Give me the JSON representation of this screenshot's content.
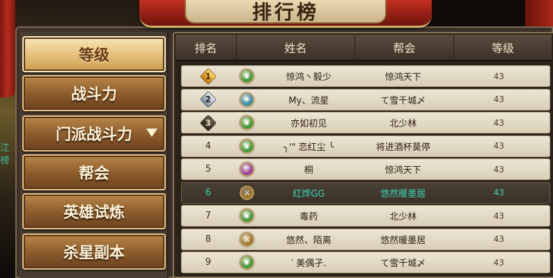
{
  "title": "排行榜",
  "side_glyph": "江\n榜",
  "menu": {
    "items": [
      {
        "label": "等级",
        "active": true,
        "dropdown": false
      },
      {
        "label": "战斗力",
        "active": false,
        "dropdown": false
      },
      {
        "label": "门派战斗力",
        "active": false,
        "dropdown": true
      },
      {
        "label": "帮会",
        "active": false,
        "dropdown": false
      },
      {
        "label": "英雄试炼",
        "active": false,
        "dropdown": false
      },
      {
        "label": "杀星副本",
        "active": false,
        "dropdown": false
      }
    ]
  },
  "table": {
    "headers": {
      "rank": "排名",
      "name": "姓名",
      "guild": "帮会",
      "level": "等级"
    },
    "rows": [
      {
        "rank": "1",
        "medal": "gold",
        "sect_icon": "leaf-icon",
        "sect_color": "#3f9a3a",
        "name": "惊鸿丶毅少",
        "guild": "惊鸿天下",
        "level": "43",
        "highlight": false
      },
      {
        "rank": "2",
        "medal": "silver",
        "sect_icon": "crystal-icon",
        "sect_color": "#2f8fb0",
        "name": "My、流星",
        "guild": "て雪千城〆",
        "level": "43",
        "highlight": false
      },
      {
        "rank": "3",
        "medal": "bronze",
        "sect_icon": "leaf-icon",
        "sect_color": "#3f9a3a",
        "name": "亦如初见",
        "guild": "北少林",
        "level": "43",
        "highlight": false
      },
      {
        "rank": "4",
        "medal": "",
        "sect_icon": "leaf-icon",
        "sect_color": "#3f9a3a",
        "name": "╮'\" 恋红尘 ╰",
        "guild": "将进酒杯莫停",
        "level": "43",
        "highlight": false
      },
      {
        "rank": "5",
        "medal": "",
        "sect_icon": "staff-icon",
        "sect_color": "#9a3aa0",
        "name": "桐",
        "guild": "惊鸿天下",
        "level": "43",
        "highlight": false
      },
      {
        "rank": "6",
        "medal": "",
        "sect_icon": "sword-icon",
        "sect_color": "#a0782a",
        "name": "红烨GG",
        "guild": "悠然暖墨居",
        "level": "43",
        "highlight": true
      },
      {
        "rank": "7",
        "medal": "",
        "sect_icon": "leaf-icon",
        "sect_color": "#3f9a3a",
        "name": "毒药",
        "guild": "北少林",
        "level": "43",
        "highlight": false
      },
      {
        "rank": "8",
        "medal": "",
        "sect_icon": "sword-icon",
        "sect_color": "#a0782a",
        "name": "悠然、陌离",
        "guild": "悠然暖墨居",
        "level": "43",
        "highlight": false
      },
      {
        "rank": "9",
        "medal": "",
        "sect_icon": "leaf-icon",
        "sect_color": "#3f9a3a",
        "name": "′ 美偶孑.",
        "guild": "て雪千城〆",
        "level": "43",
        "highlight": false
      }
    ]
  }
}
